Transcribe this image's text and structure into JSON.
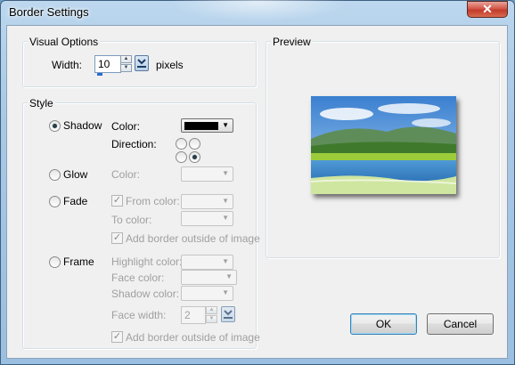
{
  "window": {
    "title": "Border Settings",
    "close_glyph": "✕"
  },
  "visual_options": {
    "legend": "Visual Options",
    "width_label": "Width:",
    "width_value": "10",
    "width_unit": "pixels"
  },
  "style": {
    "legend": "Style",
    "shadow": {
      "label": "Shadow",
      "selected": true,
      "color_label": "Color:",
      "color_value": "#000000",
      "direction_label": "Direction:",
      "direction_selected": "bottom-right"
    },
    "glow": {
      "label": "Glow",
      "color_label": "Color:"
    },
    "fade": {
      "label": "Fade",
      "from_color_label": "From color:",
      "to_color_label": "To color:",
      "add_border_label": "Add border outside of image"
    },
    "frame": {
      "label": "Frame",
      "highlight_label": "Highlight color:",
      "face_label": "Face color:",
      "shadow_label": "Shadow color:",
      "face_width_label": "Face width:",
      "face_width_value": "2",
      "add_border_label": "Add border outside of image"
    }
  },
  "preview": {
    "legend": "Preview"
  },
  "buttons": {
    "ok": "OK",
    "cancel": "Cancel"
  }
}
